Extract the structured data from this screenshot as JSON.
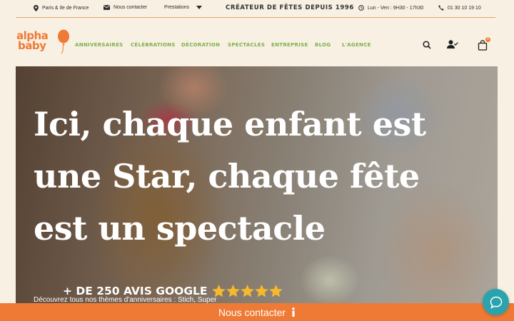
{
  "topbar": {
    "location": "Paris & Ile de France",
    "contact": "Nous contacter",
    "prestations": "Prestations",
    "tagline": "CRÉATEUR DE FÊTES DEPUIS 1996",
    "hours": "Lun - Ven : 9H30 - 17h30",
    "phone": "01 30 10 19 10"
  },
  "logo": {
    "line1": "alpha",
    "line2": "baby"
  },
  "nav": [
    "ANNIVERSAIRES",
    "CÉLÉBRATIONS",
    "DÉCORATION",
    "SPECTACLES",
    "ENTREPRISE",
    "BLOG",
    "L'AGENCE"
  ],
  "cart": {
    "count": "0"
  },
  "hero": {
    "headline": "Ici, chaque enfant est une Star, chaque fête est un spectacle",
    "reviews": "+ DE 250 AVIS GOOGLE",
    "subtitle": "Découvrez tous nos thèmes d'anniversaires : Stich, Super"
  },
  "contact_bar": {
    "label": "Nous contacter",
    "icon": "info-icon"
  },
  "colors": {
    "brand_orange": "#ef7a35",
    "nav_green": "#7fb04a",
    "background": "#f7f0e3",
    "chat_teal": "#2aa3ad",
    "star_yellow": "#f5b82e"
  }
}
